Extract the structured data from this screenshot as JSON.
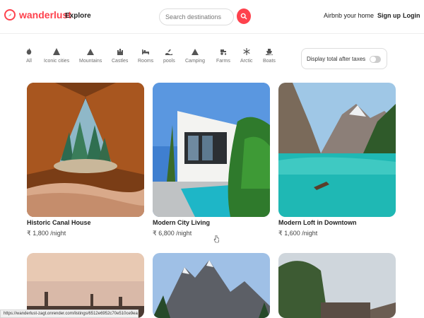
{
  "nav": {
    "brand": "wanderlust",
    "explore": "Explore",
    "search_placeholder": "Search destinations",
    "host": "Airbnb your home",
    "signup": "Sign up",
    "login": "Login",
    "accent": "#fe424d"
  },
  "filters": [
    {
      "label": "All",
      "icon": "fire-icon"
    },
    {
      "label": "Iconic cities",
      "icon": "city-icon"
    },
    {
      "label": "Mountains",
      "icon": "mountain-icon"
    },
    {
      "label": "Castles",
      "icon": "castle-icon"
    },
    {
      "label": "Rooms",
      "icon": "bed-icon"
    },
    {
      "label": "pools",
      "icon": "pool-icon"
    },
    {
      "label": "Camping",
      "icon": "tent-icon"
    },
    {
      "label": "Farms",
      "icon": "tractor-icon"
    },
    {
      "label": "Arctic",
      "icon": "snowflake-icon"
    },
    {
      "label": "Boats",
      "icon": "ship-icon"
    }
  ],
  "tax_toggle": {
    "label": "Display total after taxes",
    "enabled": false
  },
  "listings": [
    {
      "title": "Historic Canal House",
      "price": "₹ 1,800 /night"
    },
    {
      "title": "Modern City Living",
      "price": "₹ 6,800 /night"
    },
    {
      "title": "Modern Loft in Downtown",
      "price": "₹ 1,600 /night"
    }
  ],
  "status_bar": "https://wanderlust-zagt.onrender.com/listings/6512e6952c70e510ce9ea807"
}
